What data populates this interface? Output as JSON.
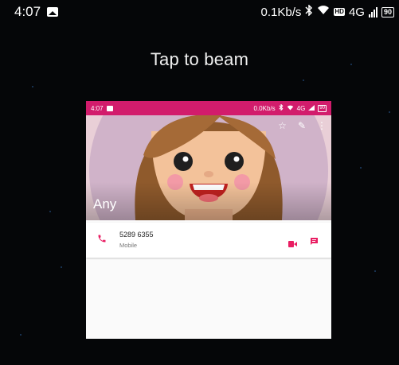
{
  "status_bar": {
    "time": "4:07",
    "network_speed": "0.1Kb/s",
    "hd_badge": "HD",
    "network_type": "4G",
    "battery": "90"
  },
  "beam": {
    "title": "Tap to beam"
  },
  "preview": {
    "status_bar": {
      "time": "4:07",
      "network_speed": "0.0Kb/s",
      "network_type": "4G",
      "battery": "90"
    },
    "contact": {
      "name": "Any",
      "phone_number": "5289 6355",
      "phone_type": "Mobile"
    },
    "colors": {
      "accent": "#d21c6c",
      "icon_accent": "#e91e63"
    }
  }
}
